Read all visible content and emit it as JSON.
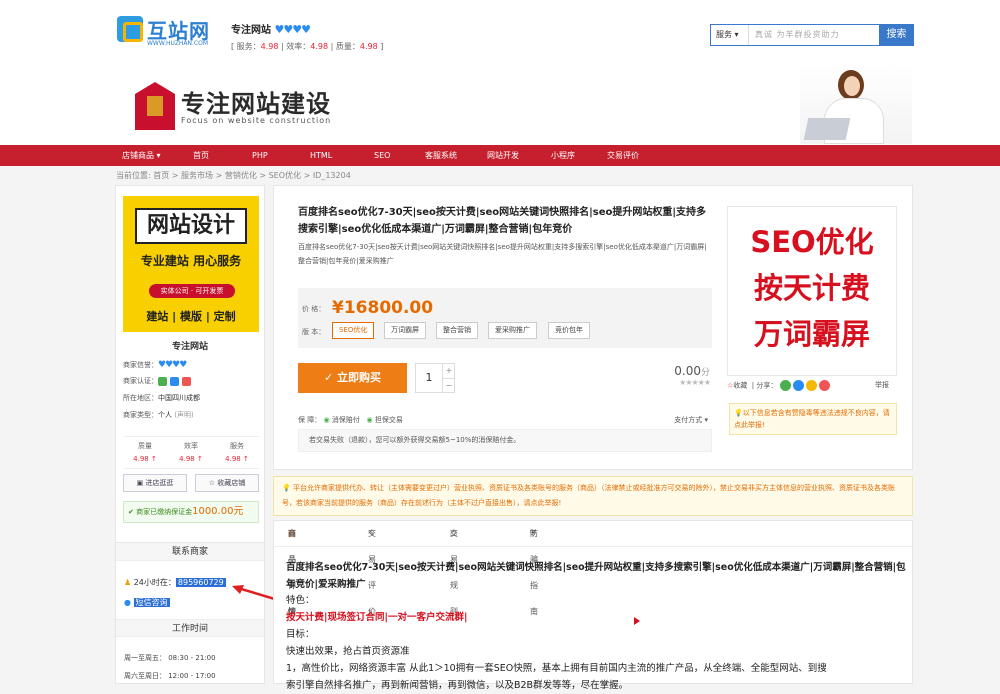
{
  "header": {
    "logo_text": "互站网",
    "logo_url": "WWW.HUZHAN.COM",
    "shop_name": "专注网站",
    "hearts": "♥♥♥♥",
    "scores": {
      "service_label": "服务：",
      "service": "4.98",
      "efficiency_label": "效率：",
      "efficiency": "4.98",
      "quality_label": "质量：",
      "quality": "4.98"
    },
    "search": {
      "scope": "服务 ▾",
      "placeholder": "真诚 为羊群投资助力",
      "button": "搜索"
    }
  },
  "banner": {
    "title": "专注网站建设",
    "subtitle": "Focus on website construction"
  },
  "nav": [
    "店铺商品 ▾",
    "首页",
    "PHP",
    "HTML",
    "SEO",
    "客服系统",
    "网站开发",
    "小程序",
    "交易评价"
  ],
  "breadcrumb": "当前位置:  首页 > 服务市场 > 营销优化 > SEO优化 > ID_13204",
  "left": {
    "img": {
      "t1": "网站设计",
      "t2": "专业建站 用心服务",
      "t3": "实体公司 · 可开发票",
      "t4": "建站 | 模版 | 定制"
    },
    "name": "专注网站",
    "credit_label": "商家信誉：",
    "credit": "♥♥♥♥",
    "cert_label": "商家认证：",
    "location_label": "所在地区：",
    "location": "中国四川成都",
    "type_label": "商家类型：",
    "type": "个人",
    "type_note": "(声明)",
    "scores": [
      {
        "label": "质量",
        "value": "4.98 ↑"
      },
      {
        "label": "效率",
        "value": "4.98 ↑"
      },
      {
        "label": "服务",
        "value": "4.98 ↑"
      }
    ],
    "btn_enter": "进店逛逛",
    "btn_fav": "收藏店铺",
    "deposit_text": "商家已缴纳保证金",
    "deposit_amount": "1000.00元"
  },
  "contact": {
    "title": "联系商家",
    "qq_label": "24小时在：",
    "qq": "895960729",
    "consult": "短信咨询",
    "hours_title": "工作时间",
    "hours": [
      "周一至周五：   08:30 - 21:00",
      "周六至周日：   12:00 - 17:00"
    ]
  },
  "product": {
    "title": "百度排名seo优化7-30天|seo按天计费|seo网站关键词快照排名|seo提升网站权重|支持多搜索引擎|seo优化低成本渠道广|万词霸屏|整合营销|包年竞价",
    "desc": "百度排名seo优化7-30天|seo按天计费|seo网站关键词快照排名|seo提升网站权重|支持多搜索引擎|seo优化低成本渠道广|万词霸屏|整合营销|包年竞价|爱采购推广",
    "price_label": "价  格：",
    "price": "¥16800.00",
    "version_label": "版  本：",
    "versions": [
      "SEO优化",
      "万词霸屏",
      "整合营销",
      "爱采购推广",
      "竞价包年"
    ],
    "buy": "✓ 立即购买",
    "qty": "1",
    "rating": "0.00",
    "rating_unit": "分",
    "stars": "★★★★★",
    "guarantee_label": "保  障：",
    "guarantee1": "消保赔付",
    "guarantee2": "担保交易",
    "pay_methods": "支付方式 ▾",
    "guarantee_note": "若交易失败（退款），您可以额外获得交易额5~10%的消保赔付金。",
    "image_lines": [
      "SEO优化",
      "按天计费",
      "万词霸屏"
    ],
    "fav": "收藏",
    "share": "分享：",
    "report": "举报",
    "warn": "💡以下信息若含有赞隐毒等违法违规不良内容，请点此举报!"
  },
  "notice": "💡 平台允许商家提供代办、转让（主体需要变更过户）营业执照、资质证书及各类账号的服务（商品）（法律禁止或经批准方可交易的除外），禁止交易非买方主体信息的营业执照、资质证书及各类账号，若该商家当前提供的服务（商品）存在前述行为（主体不过户直接出售），请点此举报!",
  "detail": {
    "tabs": [
      "商品详情",
      "交易评价",
      "交易规则",
      "防骗指南"
    ],
    "title": "百度排名seo优化7-30天|seo按天计费|seo网站关键词快照排名|seo提升网站权重|支持多搜索引擎|seo优化低成本渠道广|万词霸屏|整合营销|包年竞价|爱采购推广",
    "lines": [
      "特色：",
      "按天计费|现场签订合同|一对一客户交流群|",
      "目标：",
      "快速出效果，抢占首页资源准",
      "1，高性价比，网络资源丰富 从此1＞10拥有一套SEO快照，基本上拥有目前国内主流的推广产品，从全终端、全能型网站、到搜",
      "索引擎自然排名推广，再到新闻营销，再到微信，以及B2B群发等等，尽在掌握。"
    ]
  },
  "colors": {
    "nav_red": "#c6202e",
    "price_orange": "#e56a00",
    "buy_orange": "#ee7d16",
    "brand_blue": "#3a78c9"
  }
}
